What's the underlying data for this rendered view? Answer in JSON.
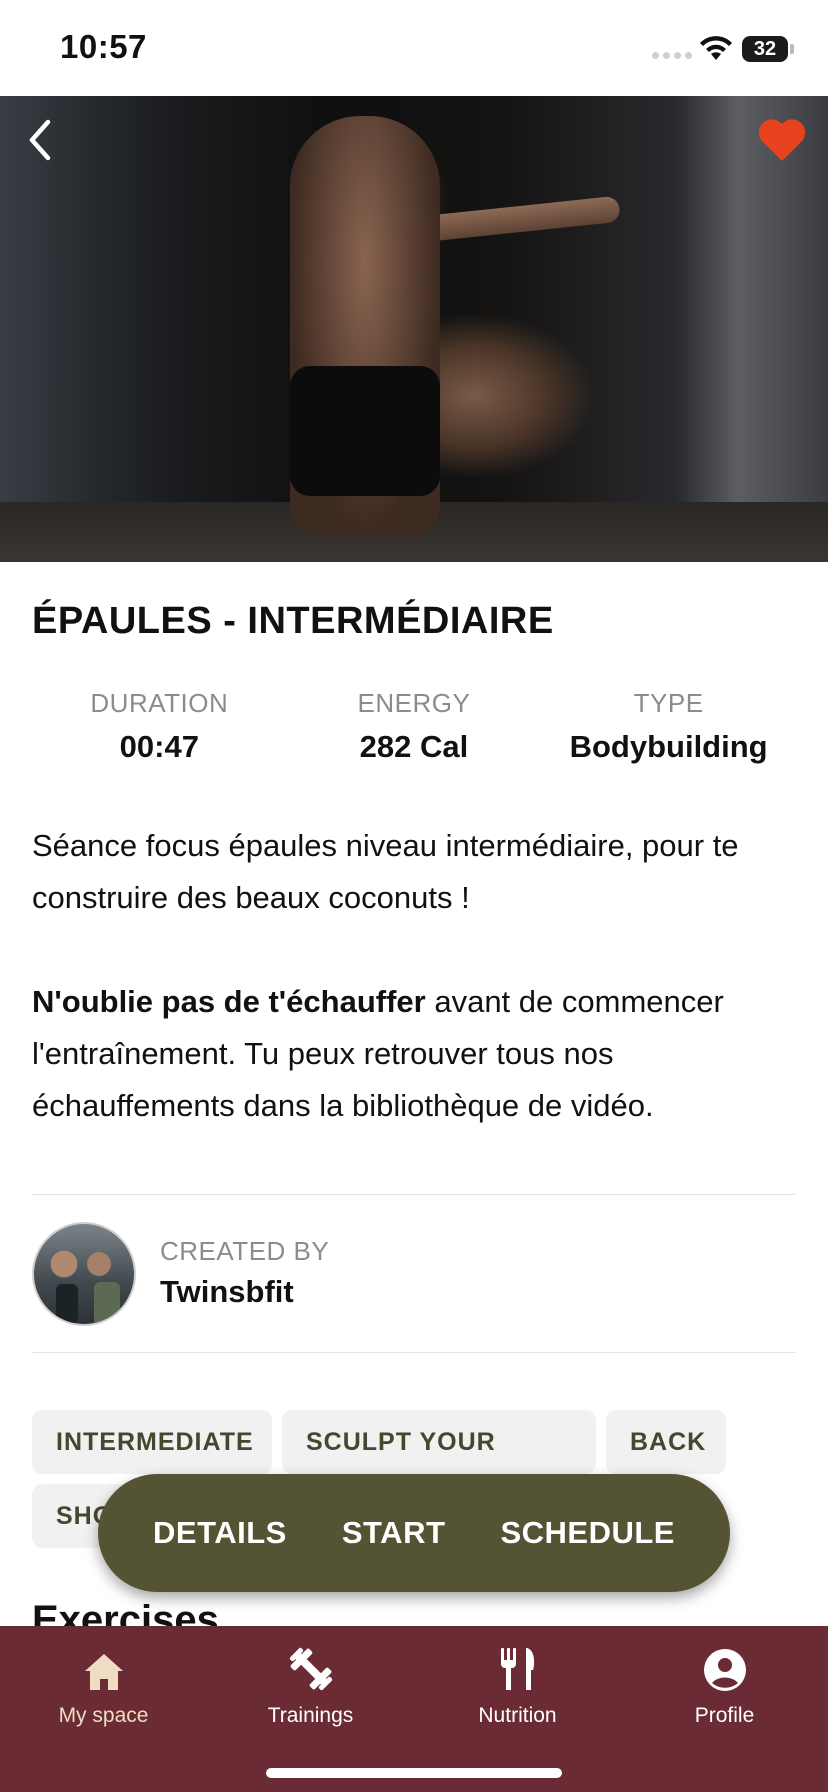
{
  "status": {
    "time": "10:57",
    "battery": "32"
  },
  "workout": {
    "title": "ÉPAULES - INTERMÉDIAIRE",
    "stats": [
      {
        "label": "DURATION",
        "value": "00:47"
      },
      {
        "label": "ENERGY",
        "value": "282 Cal"
      },
      {
        "label": "TYPE",
        "value": "Bodybuilding"
      }
    ],
    "description_line1": "Séance focus épaules niveau intermédiaire, pour te construire des beaux coconuts !",
    "description_bold": "N'oublie pas de t'échauffer",
    "description_rest": " avant de commencer l'entraînement. Tu peux retrouver tous nos échauffements dans la bibliothèque de vidéo."
  },
  "creator": {
    "label": "CREATED BY",
    "name": "Twinsbfit"
  },
  "tags": [
    "INTERMEDIATE",
    "SCULPT YOUR BODY",
    "BACK",
    "SHO"
  ],
  "section_title": "Exercises",
  "actions": [
    "DETAILS",
    "START",
    "SCHEDULE"
  ],
  "tabbar": {
    "items": [
      {
        "label": "My space",
        "icon": "home-icon",
        "active": true
      },
      {
        "label": "Trainings",
        "icon": "dumbbell-icon",
        "active": false
      },
      {
        "label": "Nutrition",
        "icon": "fork-knife-icon",
        "active": false
      },
      {
        "label": "Profile",
        "icon": "profile-icon",
        "active": false
      }
    ]
  },
  "colors": {
    "tabbar_bg": "#6b2b35",
    "action_bar_bg": "#545333",
    "heart": "#e8431f",
    "active_tab": "#eedcc5"
  }
}
